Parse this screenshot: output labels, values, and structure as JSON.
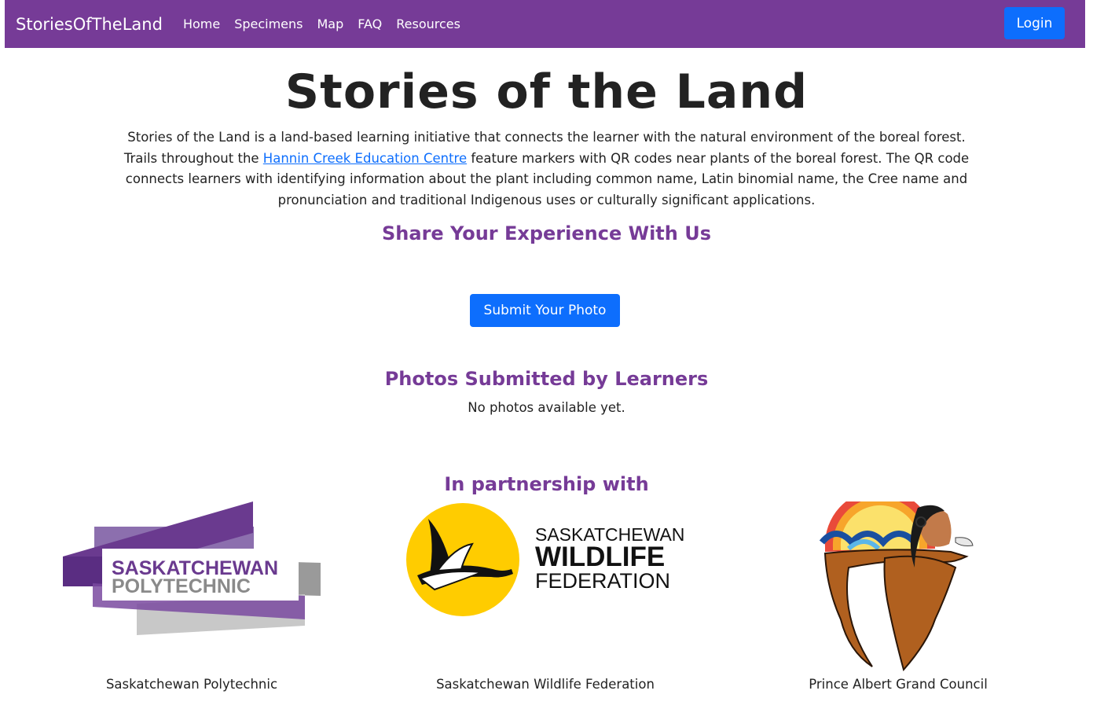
{
  "navbar": {
    "brand": "StoriesOfTheLand",
    "links": [
      "Home",
      "Specimens",
      "Map",
      "FAQ",
      "Resources"
    ],
    "login_label": "Login",
    "bg_color": "#763b97"
  },
  "hero": {
    "title": "Stories of the Land",
    "intro_before_link": "Stories of the Land is a land-based learning initiative that connects the learner with the natural environment of the boreal forest. Trails throughout the ",
    "intro_link": "Hannin Creek Education Centre",
    "intro_after_link": " feature markers with QR codes near plants of the boreal forest. The QR code connects learners with identifying information about the plant including common name, Latin binomial name, the Cree name and pronunciation and traditional Indigenous uses or culturally significant applications."
  },
  "share": {
    "heading": "Share Your Experience With Us",
    "button_label": "Submit Your Photo"
  },
  "photos": {
    "heading": "Photos Submitted by Learners",
    "empty_text": "No photos available yet."
  },
  "partners": {
    "heading": "In partnership with",
    "items": [
      {
        "name": "Saskatchewan Polytechnic",
        "logo_text": [
          "SASKATCHEWAN",
          "POLYTECHNIC"
        ]
      },
      {
        "name": "Saskatchewan Wildlife Federation",
        "logo_text": [
          "SASKATCHEWAN",
          "WILDLIFE",
          "FEDERATION"
        ]
      },
      {
        "name": "Prince Albert Grand Council"
      }
    ]
  },
  "colors": {
    "accent_purple": "#763b97",
    "button_blue": "#0d6efd",
    "swf_yellow": "#ffcc00"
  }
}
